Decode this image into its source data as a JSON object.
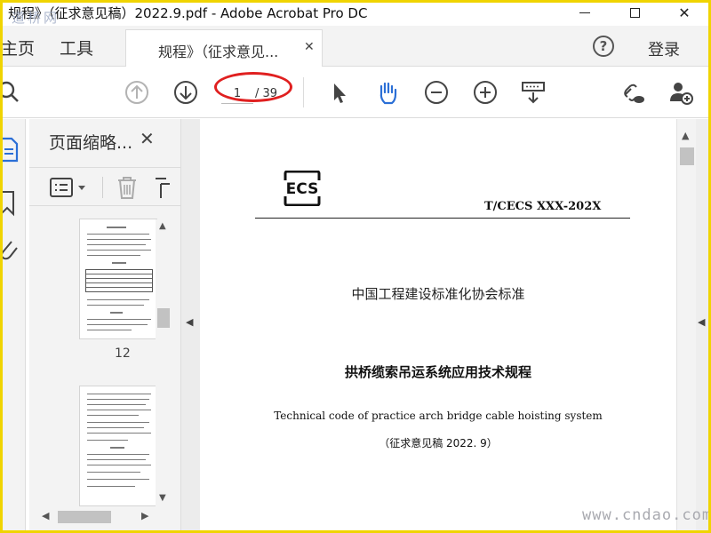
{
  "window": {
    "title": "规程》（征求意见稿）2022.9.pdf - Adobe Acrobat Pro DC",
    "watermark_top": "道桥网",
    "close_glyph": "✕"
  },
  "nav": {
    "home_label": "主页",
    "tools_label": "工具",
    "doc_tab_label": "规程》（征求意见...",
    "doc_tab_close": "✕",
    "help_glyph": "?",
    "login_label": "登录"
  },
  "toolbar": {
    "page_current": "1",
    "page_total": "/ 39",
    "annotation_color": "#e02020",
    "accent_color": "#2b6fd6"
  },
  "thumbnail_panel": {
    "title": "页面缩略...",
    "close_glyph": "✕",
    "page_label": "12"
  },
  "document": {
    "logo_text": "ECS",
    "standard_number": "T/CECS  XXX-202X",
    "organization": "中国工程建设标准化协会标准",
    "title_cn": "拱桥缆索吊运系统应用技术规程",
    "title_en": "Technical code of practice arch bridge cable hoisting system",
    "draft_note": "（征求意见稿 2022. 9）"
  },
  "watermark_bottom": "www.cndao.com"
}
